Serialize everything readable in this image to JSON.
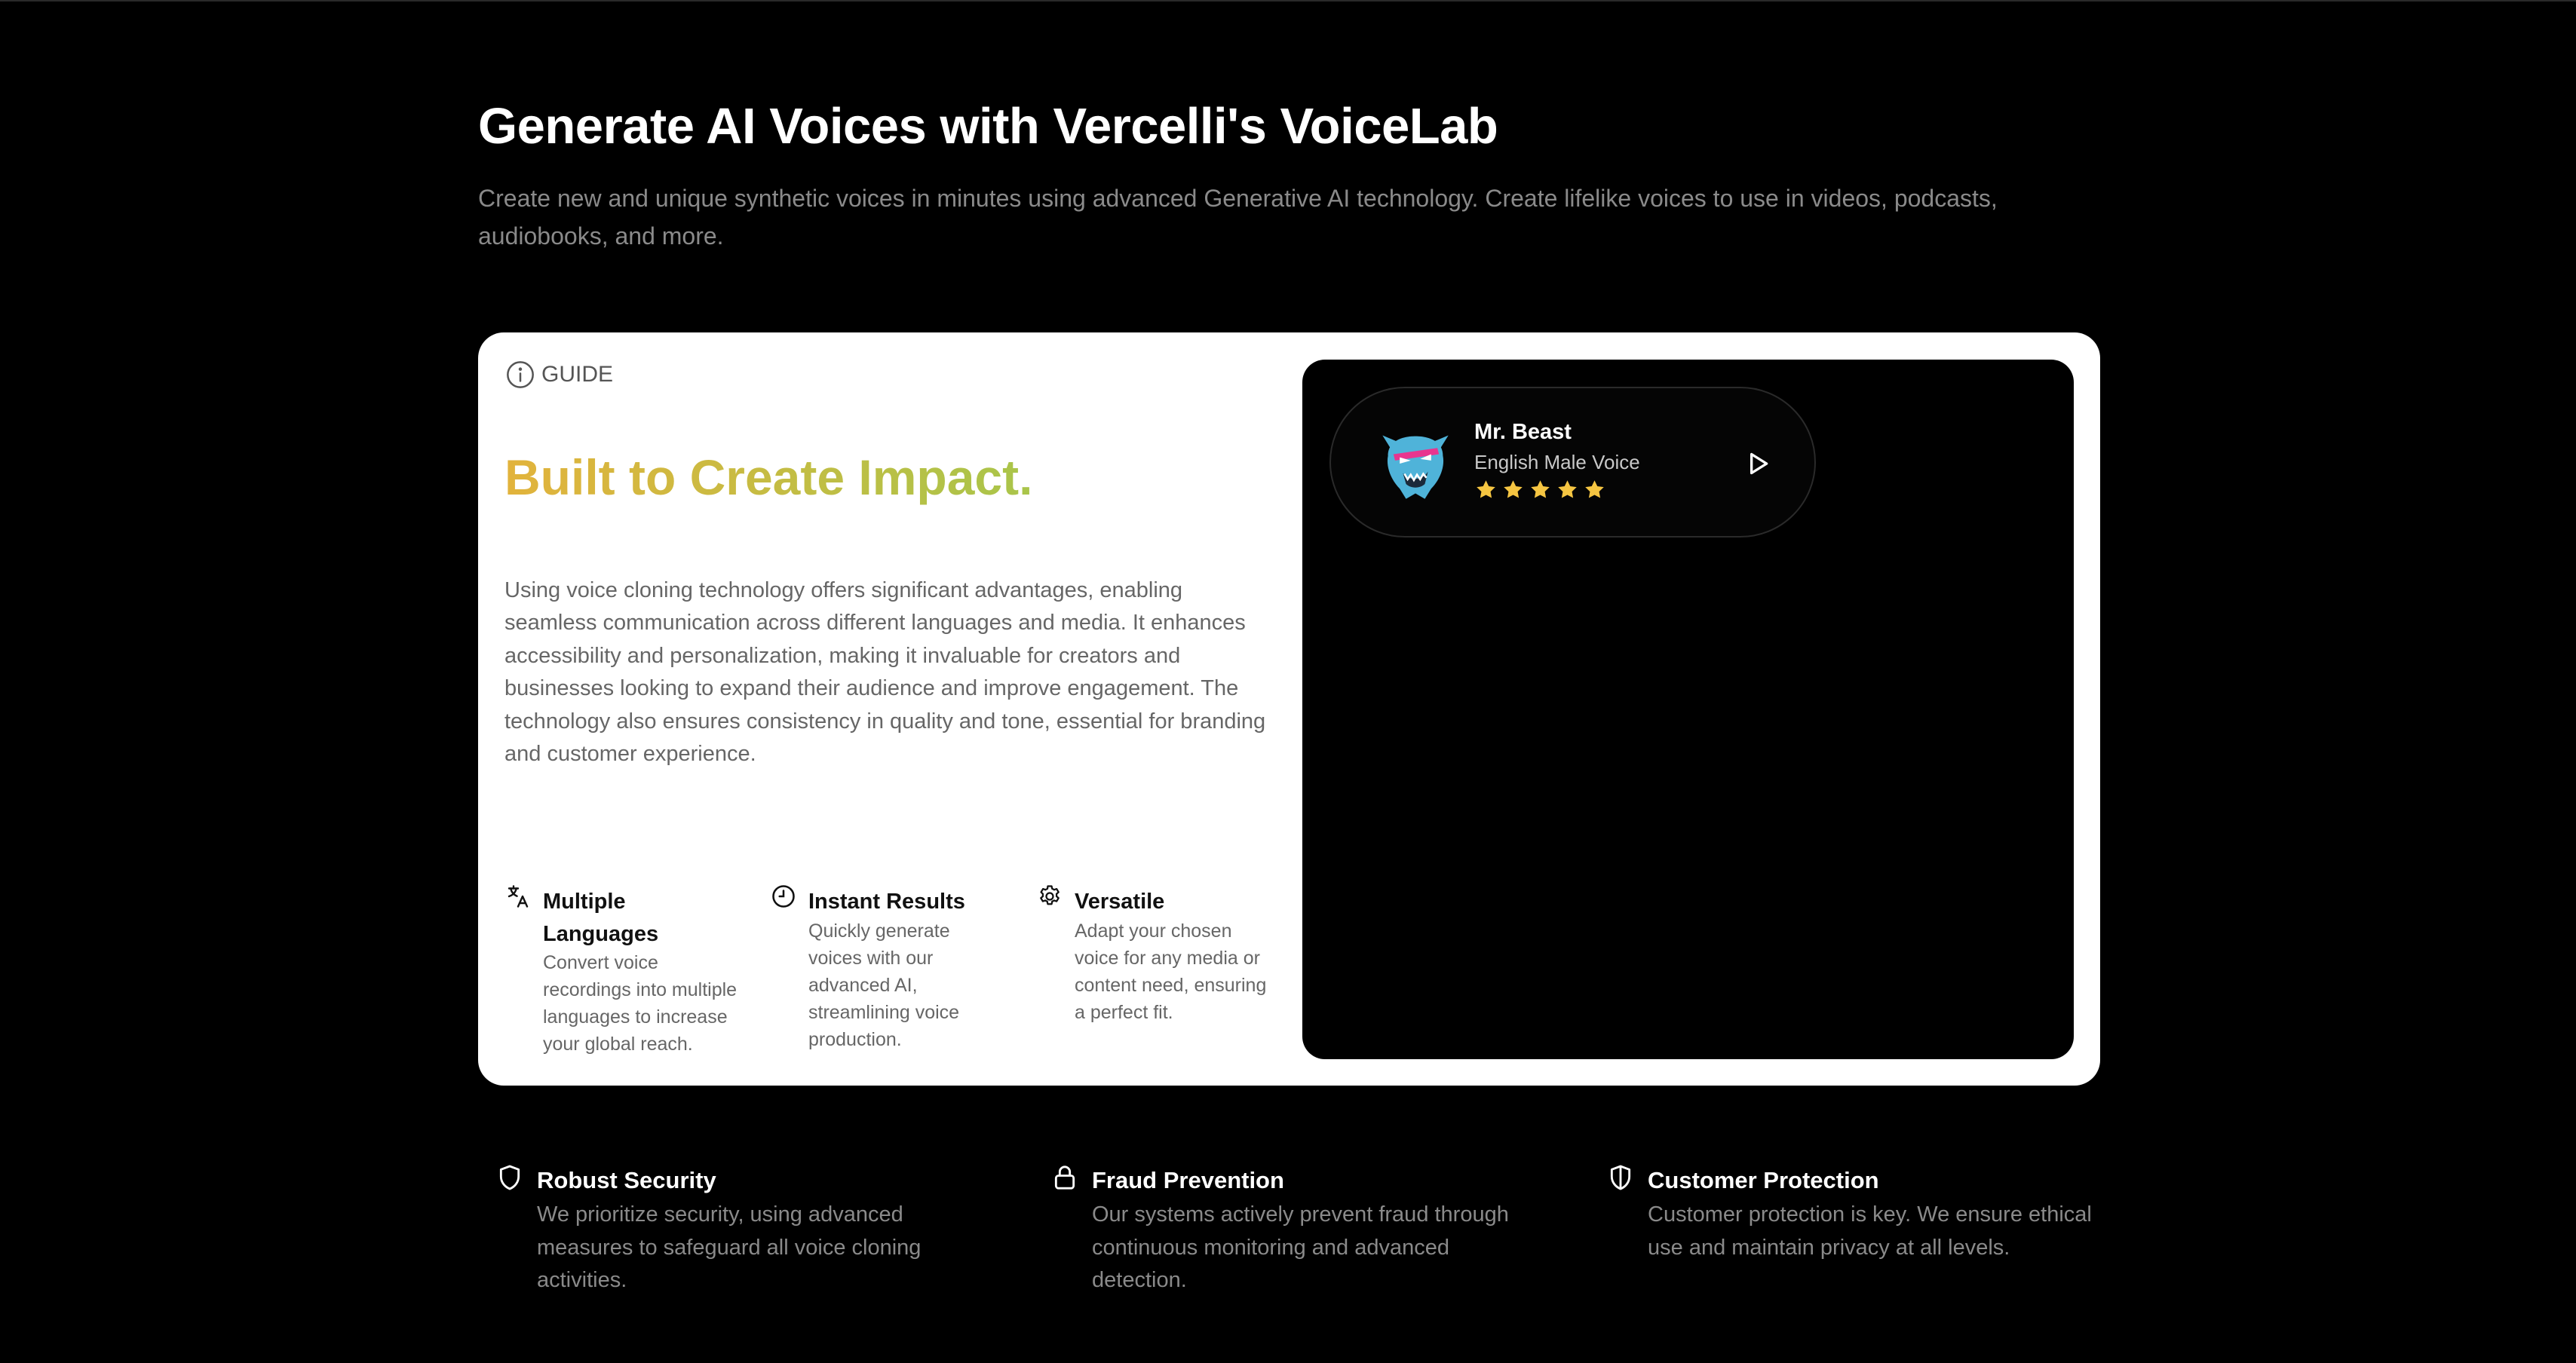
{
  "hero": {
    "title": "Generate AI Voices with Vercelli's VoiceLab",
    "subtitle": "Create new and unique synthetic voices in minutes using advanced Generative AI technology. Create lifelike voices to use in videos, podcasts, audiobooks, and more."
  },
  "guide_card": {
    "badge_label": "GUIDE",
    "badge_icon": "info-circle-icon",
    "heading": "Built to Create Impact.",
    "heading_gradient": [
      "#e2b33c",
      "#a9c54a"
    ],
    "body": "Using voice cloning technology offers significant advantages, enabling seamless communication across different languages and media. It enhances accessibility and personalization, making it invaluable for creators and businesses looking to expand their audience and improve engagement. The technology also ensures consistency in quality and tone, essential for branding and customer experience.",
    "features": [
      {
        "icon": "translate-icon",
        "title": "Multiple Languages",
        "text": "Convert voice recordings into multiple languages to increase your global reach."
      },
      {
        "icon": "clock-icon",
        "title": "Instant Results",
        "text": "Quickly generate voices with our advanced AI, streamlining voice production."
      },
      {
        "icon": "gear-icon",
        "title": "Versatile",
        "text": "Adapt your chosen voice for any media or content need, ensuring a perfect fit."
      }
    ]
  },
  "voice_player": {
    "name": "Mr. Beast",
    "description": "English Male Voice",
    "rating": 5,
    "rating_max": 5,
    "star_color": "#f5c542",
    "avatar_icon": "beast-logo-icon",
    "play_icon": "play-icon"
  },
  "bottom_features": [
    {
      "icon": "shield-icon",
      "title": "Robust Security",
      "text": "We prioritize security, using advanced measures to safeguard all voice cloning activities."
    },
    {
      "icon": "lock-icon",
      "title": "Fraud Prevention",
      "text": "Our systems actively prevent fraud through continuous monitoring and advanced detection."
    },
    {
      "icon": "shield-half-icon",
      "title": "Customer Protection",
      "text": "Customer protection is key. We ensure ethical use and maintain privacy at all levels."
    }
  ],
  "colors": {
    "background": "#000000",
    "card": "#ffffff",
    "muted_text": "#8a8a8a"
  }
}
